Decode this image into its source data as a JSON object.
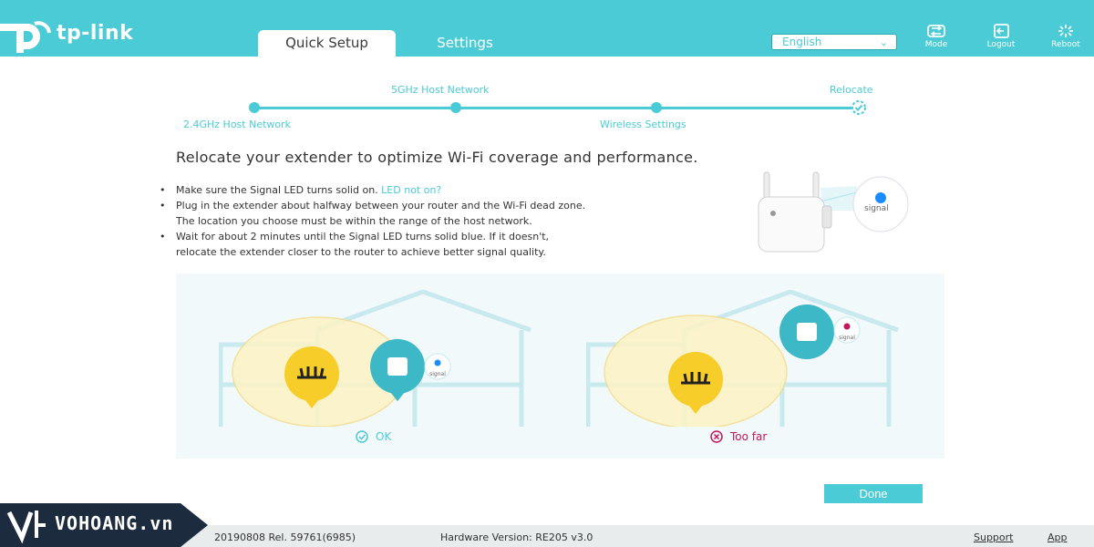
{
  "header": {
    "brand": "tp-link",
    "tabs": [
      {
        "label": "Quick Setup",
        "active": true
      },
      {
        "label": "Settings",
        "active": false
      }
    ],
    "language": "English",
    "buttons": {
      "mode": "Mode",
      "logout": "Logout",
      "reboot": "Reboot"
    },
    "accent": "#4acbd6"
  },
  "progress": {
    "steps": [
      {
        "label": "2.4GHz Host Network"
      },
      {
        "label": "5GHz Host Network"
      },
      {
        "label": "Wireless Settings"
      },
      {
        "label": "Relocate"
      }
    ],
    "current": 4
  },
  "main": {
    "title": "Relocate your extender to optimize Wi-Fi coverage and performance.",
    "bullet1_text": "Make sure the Signal LED turns solid on.",
    "bullet1_link": "LED not on?",
    "bullet2_line1": "Plug in the extender about halfway between your router and the Wi-Fi dead zone.",
    "bullet2_line2": "The location you choose must be within the range of the host network.",
    "bullet3_line1": "Wait for about 2 minutes until the Signal LED turns solid blue. If it doesn't,",
    "bullet3_line2": "relocate the extender closer to the router to achieve better signal quality.",
    "signal_label": "signal",
    "ok_label": "OK",
    "far_label": "Too far",
    "done_label": "Done"
  },
  "footer": {
    "firmware": "20190808 Rel. 59761(6985)",
    "hardware": "Hardware Version: RE205 v3.0",
    "support": "Support",
    "app": "App"
  },
  "watermark": {
    "text": "VOHOANG.vn"
  }
}
